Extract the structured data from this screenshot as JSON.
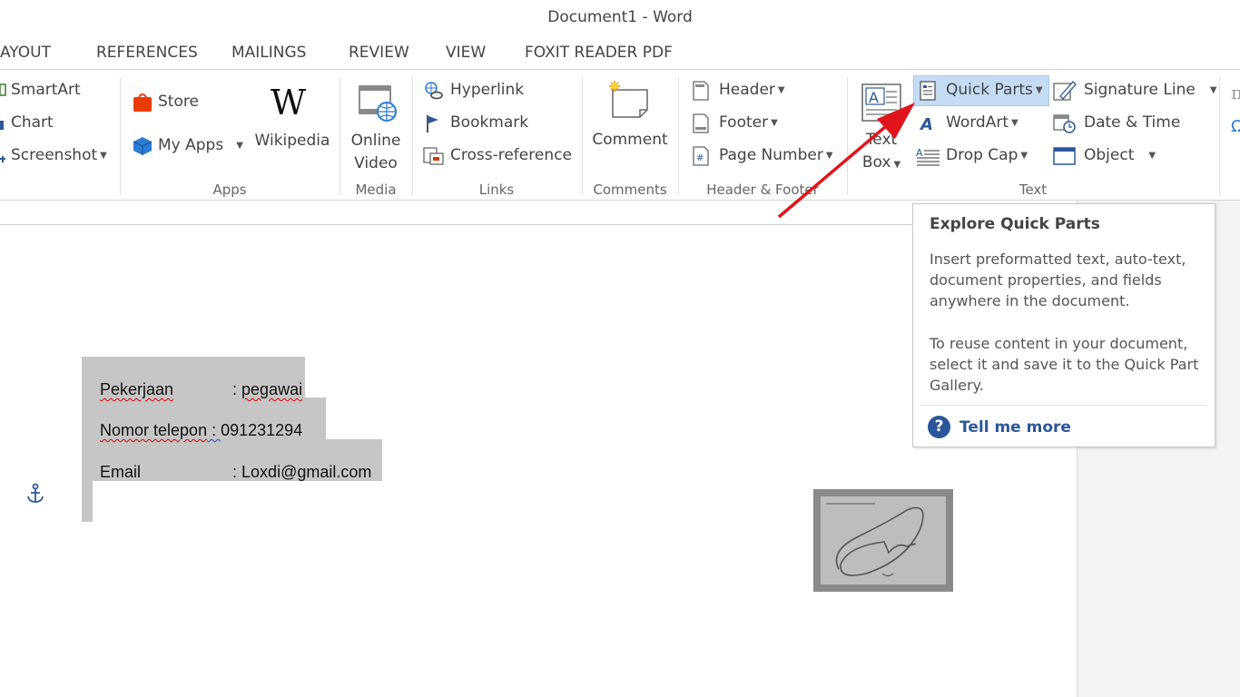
{
  "window": {
    "title": "Document1 - Word"
  },
  "tabs": [
    "AYOUT",
    "REFERENCES",
    "MAILINGS",
    "REVIEW",
    "VIEW",
    "FOXIT READER PDF"
  ],
  "ribbon": {
    "illustrations": {
      "smartart": "SmartArt",
      "chart": "Chart",
      "screenshot": "Screenshot"
    },
    "apps": {
      "store": "Store",
      "my_apps": "My Apps",
      "wikipedia": "Wikipedia",
      "group": "Apps"
    },
    "media": {
      "online_video_1": "Online",
      "online_video_2": "Video",
      "group": "Media"
    },
    "links": {
      "hyperlink": "Hyperlink",
      "bookmark": "Bookmark",
      "cross_reference": "Cross-reference",
      "group": "Links"
    },
    "comments": {
      "comment": "Comment",
      "group": "Comments"
    },
    "header_footer": {
      "header": "Header",
      "footer": "Footer",
      "page_number": "Page Number",
      "group": "Header & Footer"
    },
    "text": {
      "text_box_1": "Text",
      "text_box_2": "Box",
      "quick_parts": "Quick Parts",
      "wordart": "WordArt",
      "drop_cap": "Drop Cap",
      "signature_line": "Signature Line",
      "date_time": "Date & Time",
      "object": "Object",
      "group": "Text"
    }
  },
  "tooltip": {
    "title": "Explore Quick Parts",
    "p1": "Insert preformatted text, auto-text, document properties, and fields anywhere in the document.",
    "p2": "To reuse content in your document, select it and save it to the Quick Part Gallery.",
    "help": "Tell me more"
  },
  "document": {
    "line1_label": "Pekerjaan",
    "line1_sep": ": ",
    "line1_value": "pegawai",
    "line2_label": "Nomor telepon",
    "line2_sep": " : ",
    "line2_value": "091231294",
    "line3_label": "Email",
    "line3_sep": ": ",
    "line3_value": "Loxdi@gmail.com"
  },
  "colors": {
    "accent": "#2b579a",
    "selection": "#c6c6c6",
    "arrow": "#e0141b"
  }
}
